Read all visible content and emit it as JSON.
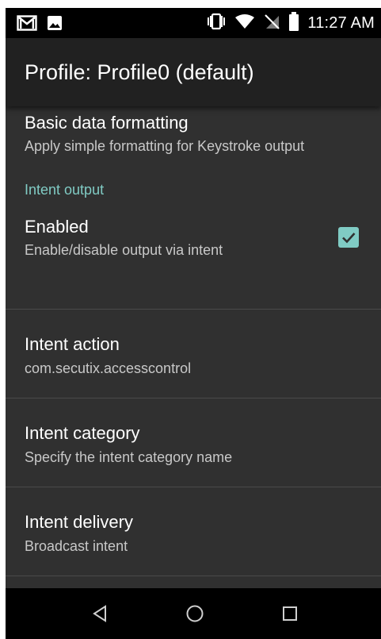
{
  "status_bar": {
    "time": "11:27 AM",
    "left_icons": [
      "gmail-icon",
      "image-icon"
    ],
    "right_icons": [
      "vibrate-icon",
      "wifi-icon",
      "no-sim-icon",
      "battery-icon"
    ]
  },
  "app_bar": {
    "title": "Profile: Profile0 (default)"
  },
  "preferences": {
    "basic_formatting": {
      "title": "Basic data formatting",
      "summary": "Apply simple formatting for Keystroke output"
    },
    "category": "Intent output",
    "enabled": {
      "title": "Enabled",
      "summary": "Enable/disable output via intent",
      "checked": true
    },
    "intent_action": {
      "title": "Intent action",
      "summary": "com.secutix.accesscontrol"
    },
    "intent_category": {
      "title": "Intent category",
      "summary": "Specify the intent category name"
    },
    "intent_delivery": {
      "title": "Intent delivery",
      "summary": "Broadcast intent"
    }
  },
  "nav_bar": {
    "buttons": [
      "back-icon",
      "home-icon",
      "recents-icon"
    ]
  },
  "colors": {
    "accent": "#80cbc4",
    "background": "#303030",
    "app_bar": "#212121"
  }
}
